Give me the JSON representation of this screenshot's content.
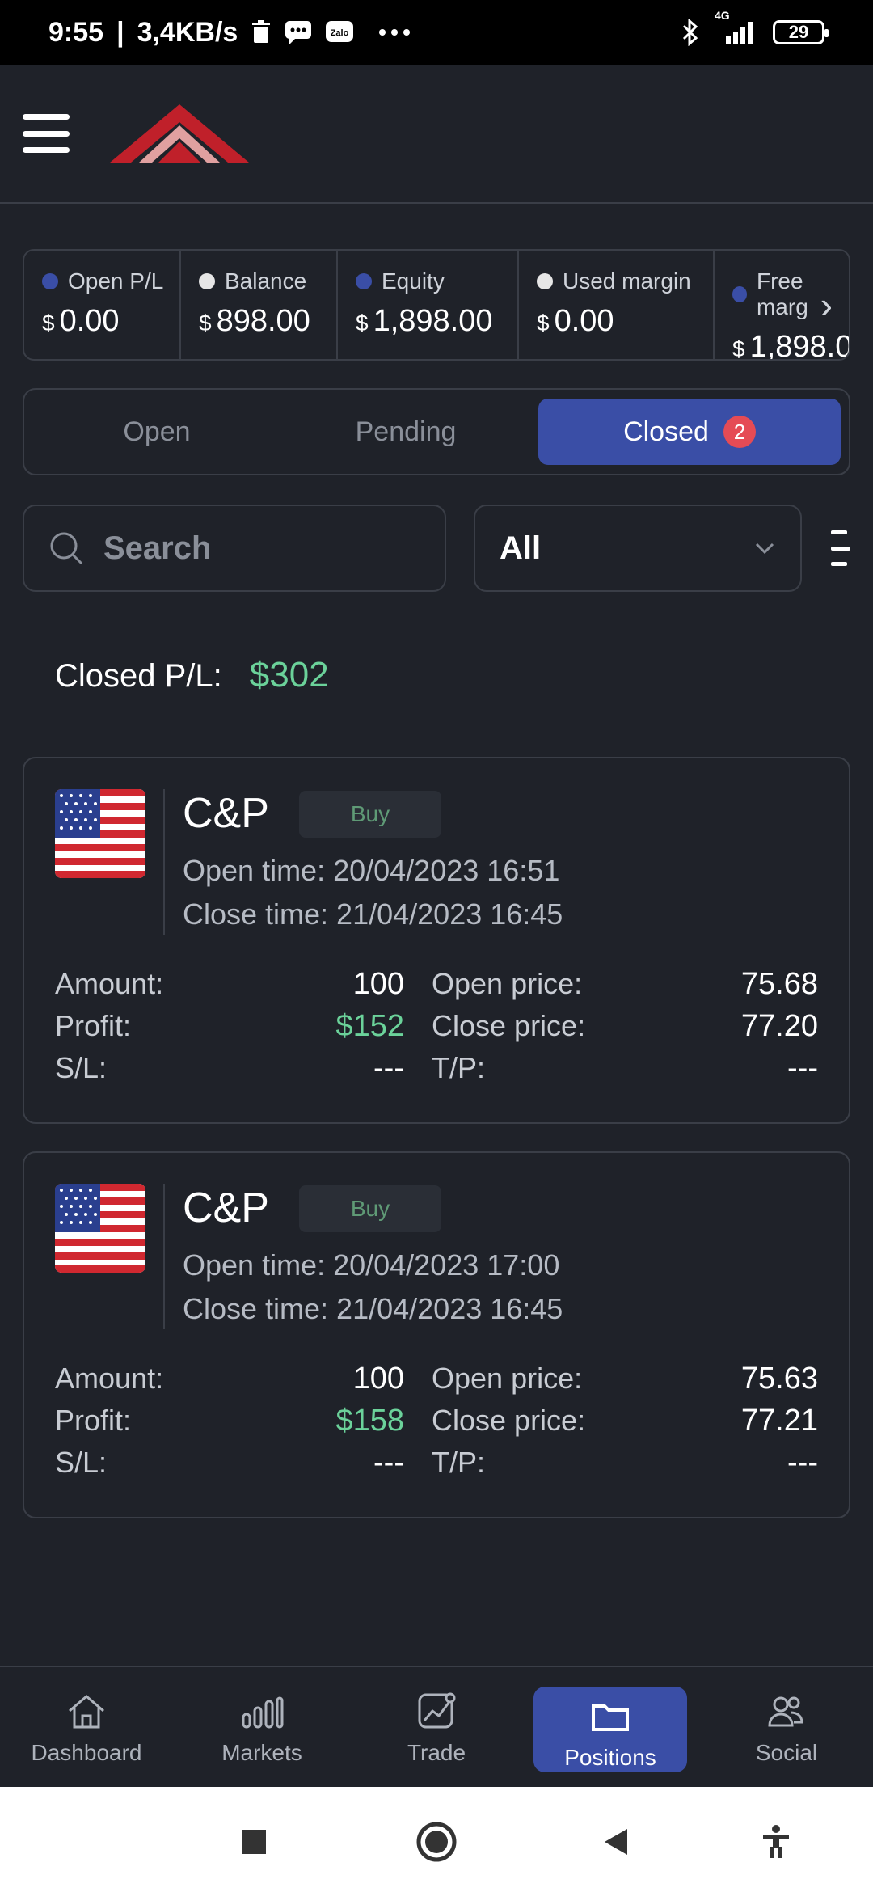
{
  "status_bar": {
    "time": "9:55",
    "speed": "3,4KB/s",
    "network": "4G",
    "battery": "29",
    "icons": [
      "trash-icon",
      "chat-icon",
      "zalo-icon",
      "more-icon",
      "bluetooth-icon",
      "signal-icon",
      "battery-icon"
    ]
  },
  "summary": [
    {
      "label": "Open P/L",
      "currency": "$",
      "value": "0.00",
      "dot": "blue"
    },
    {
      "label": "Balance",
      "currency": "$",
      "value": "898.00",
      "dot": "white"
    },
    {
      "label": "Equity",
      "currency": "$",
      "value": "1,898.00",
      "dot": "blue"
    },
    {
      "label": "Used margin",
      "currency": "$",
      "value": "0.00",
      "dot": "white"
    },
    {
      "label": "Free marg",
      "currency": "$",
      "value": "1,898.0",
      "dot": "blue"
    }
  ],
  "tabs": {
    "open": "Open",
    "pending": "Pending",
    "closed": "Closed",
    "closed_count": "2"
  },
  "filters": {
    "search_placeholder": "Search",
    "select_value": "All"
  },
  "closed_pl": {
    "label": "Closed P/L:",
    "value": "$302"
  },
  "positions": [
    {
      "symbol": "C&P",
      "side": "Buy",
      "open_time": "Open time: 20/04/2023 16:51",
      "close_time": "Close time: 21/04/2023 16:45",
      "amount_label": "Amount:",
      "amount": "100",
      "profit_label": "Profit:",
      "profit": "$152",
      "sl_label": "S/L:",
      "sl": "---",
      "open_price_label": "Open price:",
      "open_price": "75.68",
      "close_price_label": "Close price:",
      "close_price": "77.20",
      "tp_label": "T/P:",
      "tp": "---"
    },
    {
      "symbol": "C&P",
      "side": "Buy",
      "open_time": "Open time: 20/04/2023 17:00",
      "close_time": "Close time: 21/04/2023 16:45",
      "amount_label": "Amount:",
      "amount": "100",
      "profit_label": "Profit:",
      "profit": "$158",
      "sl_label": "S/L:",
      "sl": "---",
      "open_price_label": "Open price:",
      "open_price": "75.63",
      "close_price_label": "Close price:",
      "close_price": "77.21",
      "tp_label": "T/P:",
      "tp": "---"
    }
  ],
  "bottom_nav": [
    "Dashboard",
    "Markets",
    "Trade",
    "Positions",
    "Social"
  ],
  "colors": {
    "accent": "#3a4ea6",
    "profit": "#6bd29a",
    "badge": "#e54b55",
    "background": "#1f2229"
  }
}
